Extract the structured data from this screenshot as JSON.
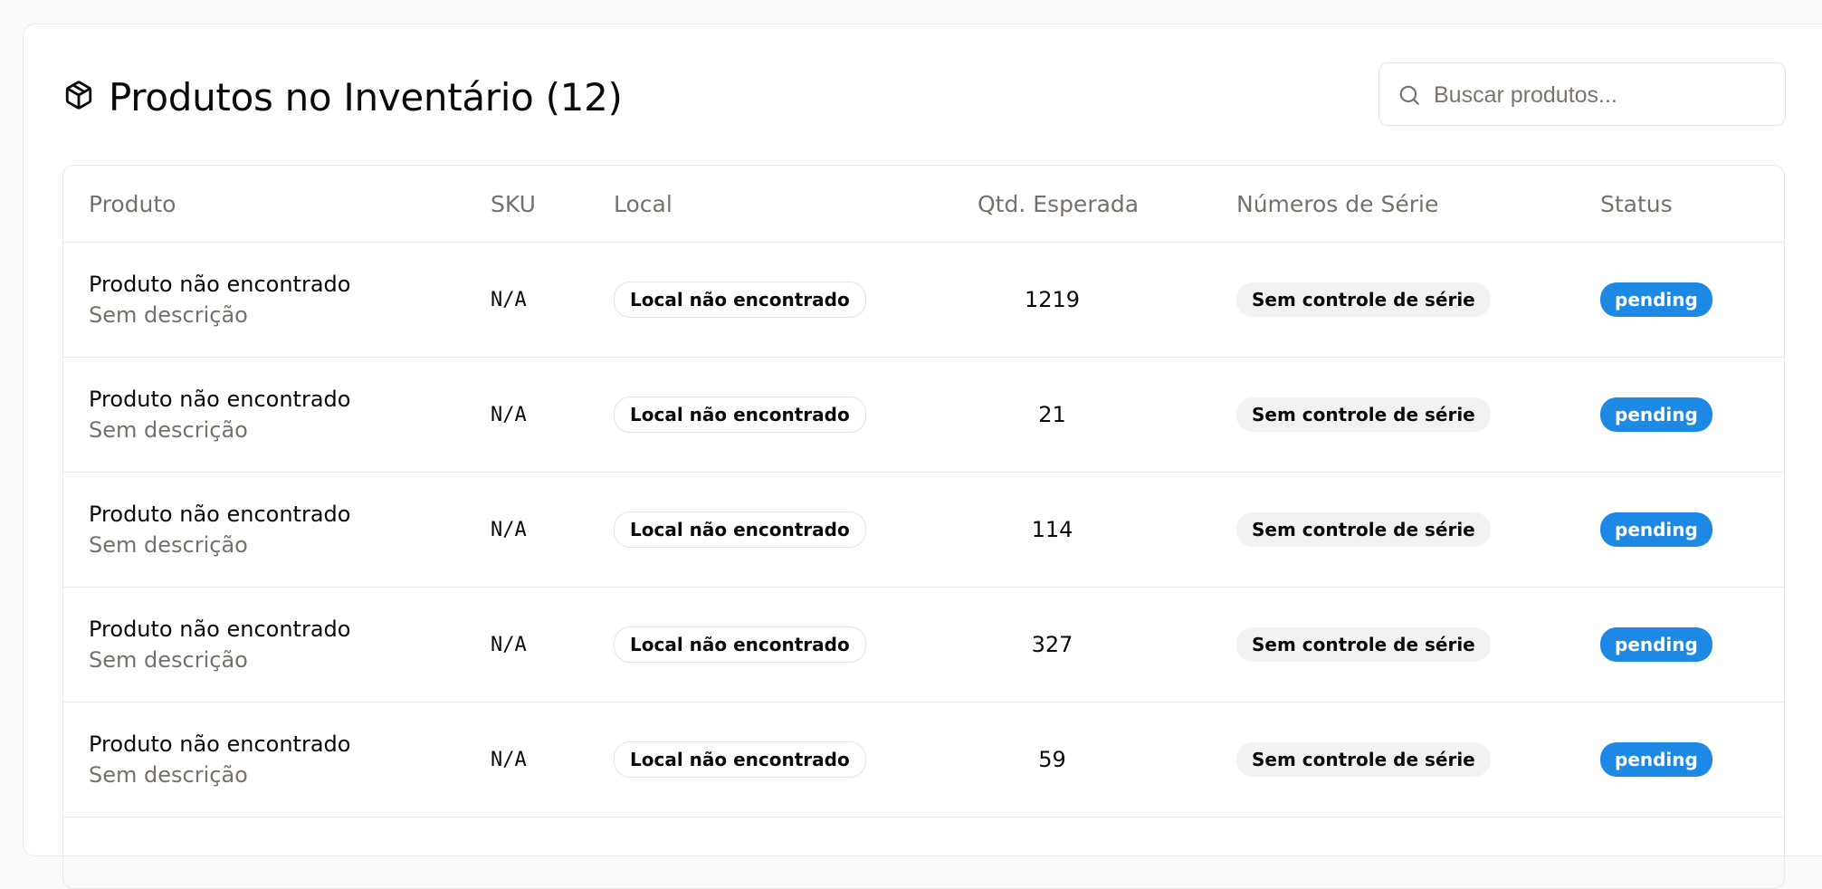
{
  "panel": {
    "title": "Produtos no Inventário (12)",
    "title_icon": "package-icon",
    "search": {
      "placeholder": "Buscar produtos...",
      "value": "",
      "icon": "search-icon"
    }
  },
  "table": {
    "headers": {
      "produto": "Produto",
      "sku": "SKU",
      "local": "Local",
      "qty": "Qtd. Esperada",
      "serie": "Números de Série",
      "status": "Status"
    },
    "rows": [
      {
        "name": "Produto não encontrado",
        "description": "Sem descrição",
        "sku": "N/A",
        "local": "Local não encontrado",
        "qty": "1219",
        "serie": "Sem controle de série",
        "status": "pending"
      },
      {
        "name": "Produto não encontrado",
        "description": "Sem descrição",
        "sku": "N/A",
        "local": "Local não encontrado",
        "qty": "21",
        "serie": "Sem controle de série",
        "status": "pending"
      },
      {
        "name": "Produto não encontrado",
        "description": "Sem descrição",
        "sku": "N/A",
        "local": "Local não encontrado",
        "qty": "114",
        "serie": "Sem controle de série",
        "status": "pending"
      },
      {
        "name": "Produto não encontrado",
        "description": "Sem descrição",
        "sku": "N/A",
        "local": "Local não encontrado",
        "qty": "327",
        "serie": "Sem controle de série",
        "status": "pending"
      },
      {
        "name": "Produto não encontrado",
        "description": "Sem descrição",
        "sku": "N/A",
        "local": "Local não encontrado",
        "qty": "59",
        "serie": "Sem controle de série",
        "status": "pending"
      }
    ]
  },
  "colors": {
    "status_pending": "#1e88e5",
    "muted_text": "#77706a",
    "border": "#e8e8e8"
  }
}
